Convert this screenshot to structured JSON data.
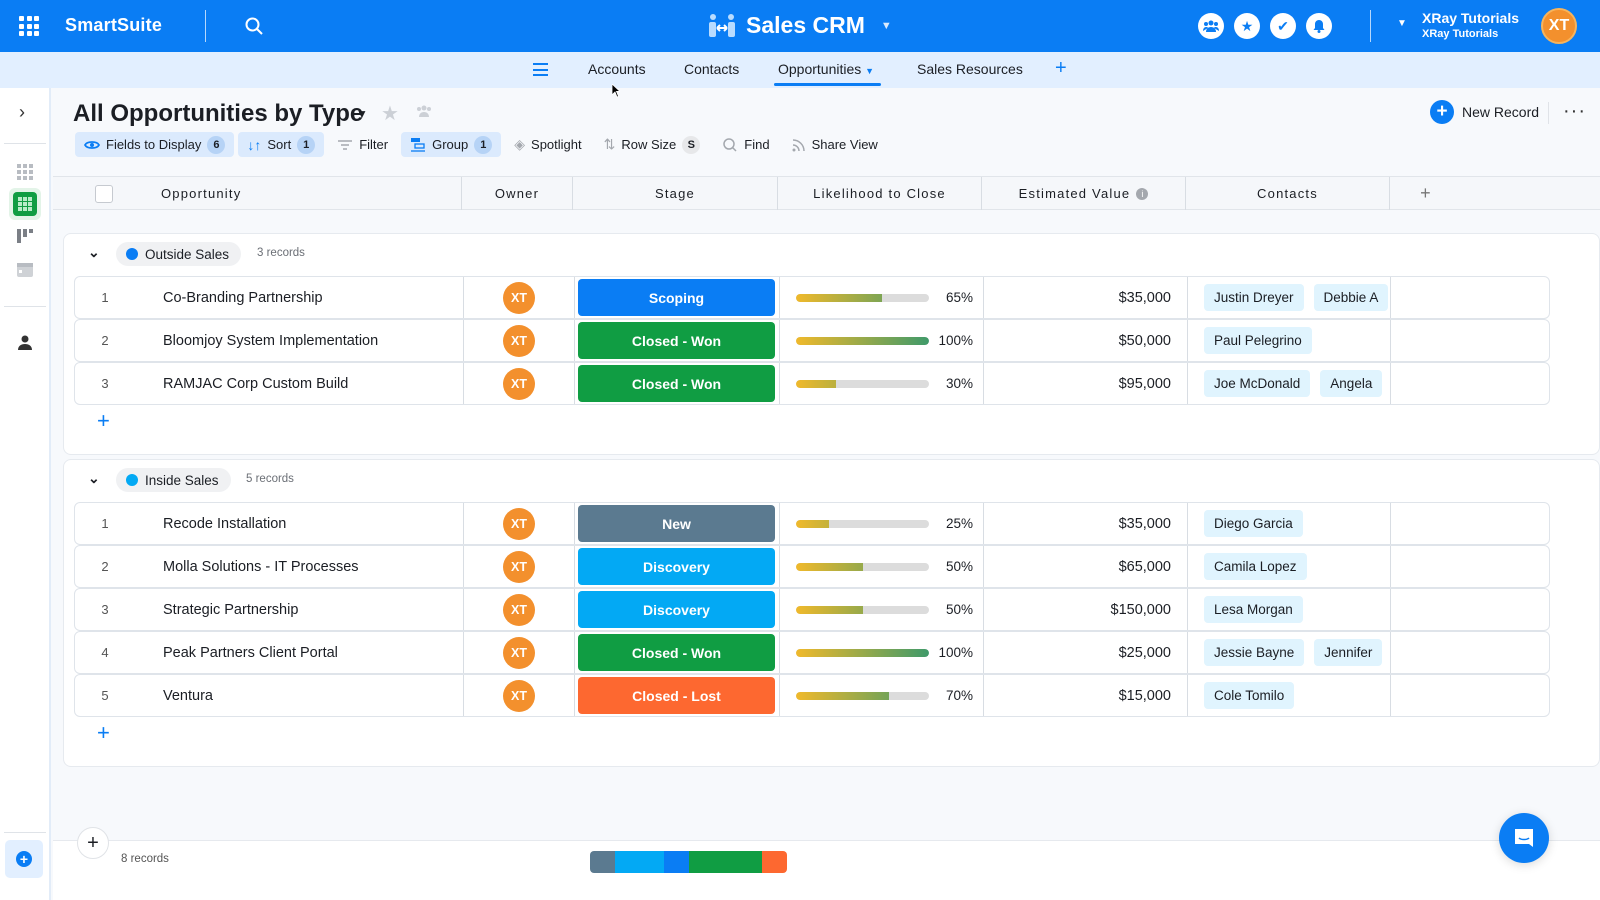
{
  "topbar": {
    "brand": "SmartSuite",
    "app_title": "Sales CRM",
    "user_name": "XRay Tutorials",
    "user_workspace": "XRay Tutorials",
    "user_initials": "XT",
    "icons": [
      "members-icon",
      "favorites-icon",
      "tasks-icon",
      "notifications-icon"
    ]
  },
  "tabs": {
    "items": [
      {
        "label": "Accounts"
      },
      {
        "label": "Contacts"
      },
      {
        "label": "Opportunities",
        "active": true
      },
      {
        "label": "Sales Resources"
      }
    ],
    "add": "+"
  },
  "view": {
    "title": "All Opportunities by Type",
    "new_record": "New Record"
  },
  "toolbar": {
    "fields_label": "Fields to Display",
    "fields_count": "6",
    "sort_label": "Sort",
    "sort_count": "1",
    "filter_label": "Filter",
    "group_label": "Group",
    "group_count": "1",
    "spotlight_label": "Spotlight",
    "rowsize_label": "Row Size",
    "rowsize_value": "S",
    "find_label": "Find",
    "share_label": "Share View"
  },
  "columns": {
    "opportunity": "Opportunity",
    "owner": "Owner",
    "stage": "Stage",
    "likelihood": "Likelihood to Close",
    "value": "Estimated Value",
    "contacts": "Contacts",
    "add": "+"
  },
  "colors": {
    "brand": "#0a7df4",
    "stage_scoping": "#0a7df4",
    "stage_closed_won": "#109d43",
    "stage_new": "#5b7a90",
    "stage_discovery": "#03a9f4",
    "stage_closed_lost": "#fd6830",
    "owner_avatar": "#f3902d"
  },
  "groups": [
    {
      "name": "Outside Sales",
      "dot": "#0a7df4",
      "count": "3 records",
      "rows": [
        {
          "num": "1",
          "name": "Co-Branding Partnership",
          "owner": "XT",
          "stage": "Scoping",
          "stage_color": "#0a7df4",
          "likelihood": 65,
          "likelihood_label": "65%",
          "value": "$35,000",
          "contacts": [
            "Justin Dreyer",
            "Debbie A"
          ]
        },
        {
          "num": "2",
          "name": "Bloomjoy System Implementation",
          "owner": "XT",
          "stage": "Closed - Won",
          "stage_color": "#109d43",
          "likelihood": 100,
          "likelihood_label": "100%",
          "value": "$50,000",
          "contacts": [
            "Paul Pelegrino"
          ]
        },
        {
          "num": "3",
          "name": "RAMJAC Corp Custom Build",
          "owner": "XT",
          "stage": "Closed - Won",
          "stage_color": "#109d43",
          "likelihood": 30,
          "likelihood_label": "30%",
          "value": "$95,000",
          "contacts": [
            "Joe McDonald",
            "Angela"
          ]
        }
      ]
    },
    {
      "name": "Inside Sales",
      "dot": "#03a9f4",
      "count": "5 records",
      "rows": [
        {
          "num": "1",
          "name": "Recode Installation",
          "owner": "XT",
          "stage": "New",
          "stage_color": "#5b7a90",
          "likelihood": 25,
          "likelihood_label": "25%",
          "value": "$35,000",
          "contacts": [
            "Diego Garcia"
          ]
        },
        {
          "num": "2",
          "name": "Molla Solutions - IT Processes",
          "owner": "XT",
          "stage": "Discovery",
          "stage_color": "#03a9f4",
          "likelihood": 50,
          "likelihood_label": "50%",
          "value": "$65,000",
          "contacts": [
            "Camila Lopez"
          ]
        },
        {
          "num": "3",
          "name": "Strategic Partnership",
          "owner": "XT",
          "stage": "Discovery",
          "stage_color": "#03a9f4",
          "likelihood": 50,
          "likelihood_label": "50%",
          "value": "$150,000",
          "contacts": [
            "Lesa Morgan"
          ]
        },
        {
          "num": "4",
          "name": "Peak Partners Client Portal",
          "owner": "XT",
          "stage": "Closed - Won",
          "stage_color": "#109d43",
          "likelihood": 100,
          "likelihood_label": "100%",
          "value": "$25,000",
          "contacts": [
            "Jessie Bayne",
            "Jennifer"
          ]
        },
        {
          "num": "5",
          "name": "Ventura",
          "owner": "XT",
          "stage": "Closed - Lost",
          "stage_color": "#fd6830",
          "likelihood": 70,
          "likelihood_label": "70%",
          "value": "$15,000",
          "contacts": [
            "Cole Tomilo"
          ]
        }
      ]
    }
  ],
  "footer": {
    "total": "8 records",
    "stage_distribution": [
      {
        "stage": "New",
        "count": 1,
        "color": "#5b7a90"
      },
      {
        "stage": "Discovery",
        "count": 2,
        "color": "#03a9f4"
      },
      {
        "stage": "Scoping",
        "count": 1,
        "color": "#0a7df4"
      },
      {
        "stage": "Closed - Won",
        "count": 3,
        "color": "#109d43"
      },
      {
        "stage": "Closed - Lost",
        "count": 1,
        "color": "#fd6830"
      }
    ]
  }
}
